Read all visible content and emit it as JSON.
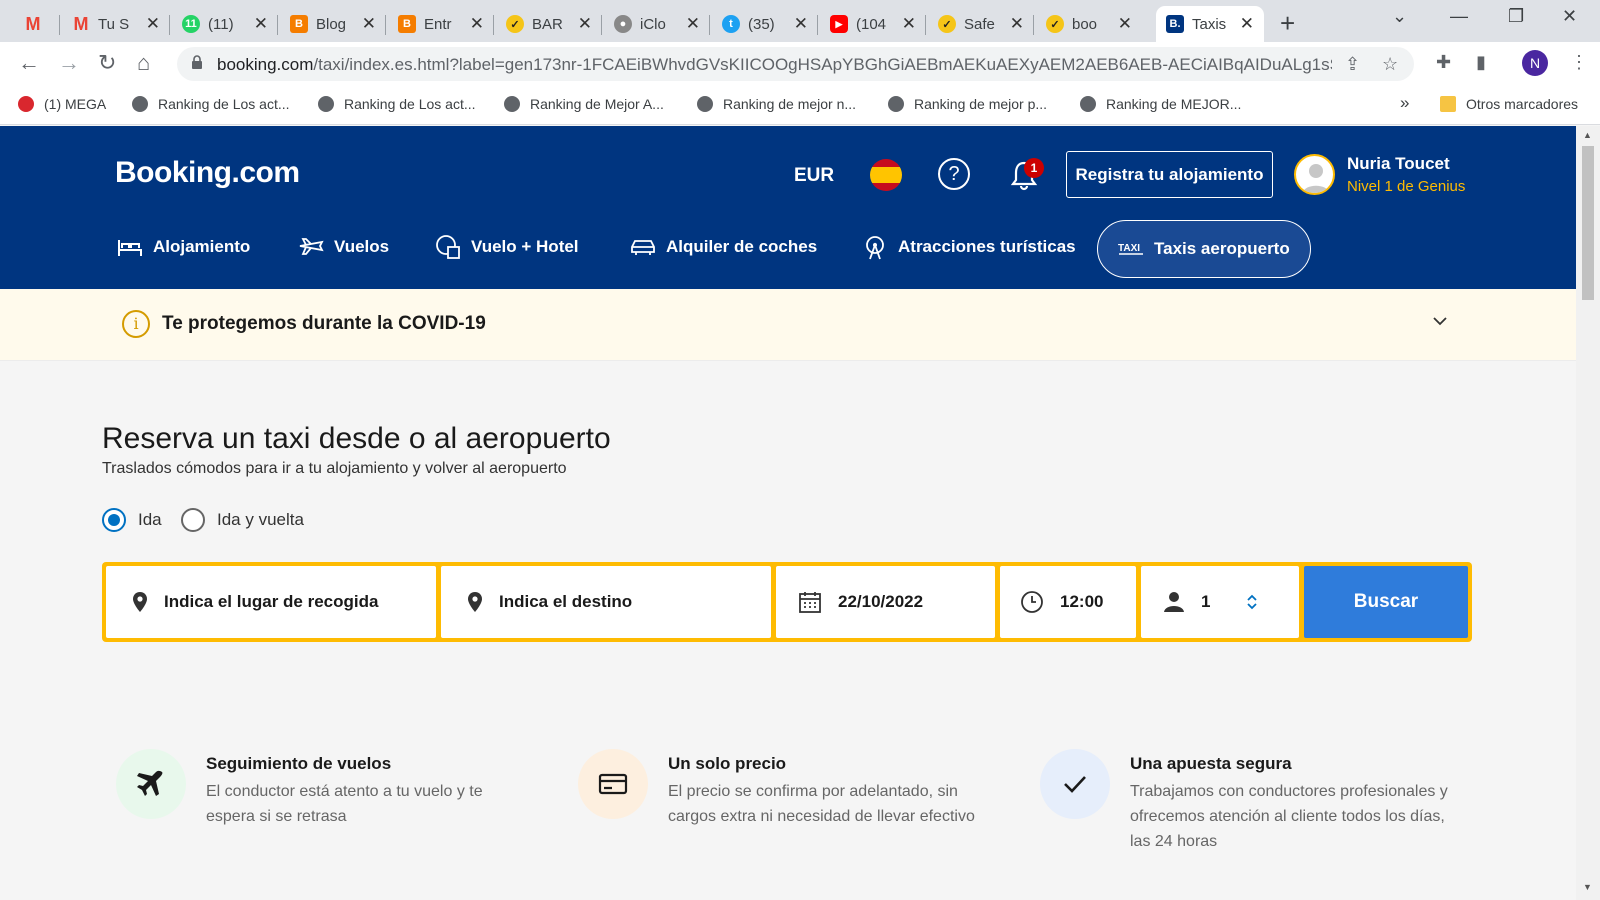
{
  "browser": {
    "tabs": [
      {
        "label": "",
        "icon": "gmail-icon",
        "color": "#ea4335"
      },
      {
        "label": "Tu S",
        "icon": "gmail-icon",
        "color": "#ea4335"
      },
      {
        "label": "(11)",
        "icon": "whatsapp-icon",
        "color": "#25d366"
      },
      {
        "label": "Blog",
        "icon": "blogger-icon",
        "color": "#f57d00"
      },
      {
        "label": "Entr",
        "icon": "blogger-icon",
        "color": "#f57d00"
      },
      {
        "label": "BAR",
        "icon": "check-icon",
        "color": "#f5c518"
      },
      {
        "label": "iClo",
        "icon": "apple-icon",
        "color": "#555555"
      },
      {
        "label": "(35)",
        "icon": "twitter-icon",
        "color": "#1da1f2"
      },
      {
        "label": "(104",
        "icon": "youtube-icon",
        "color": "#ff0000"
      },
      {
        "label": "Safe",
        "icon": "check-icon",
        "color": "#f5c518"
      },
      {
        "label": "boo",
        "icon": "check-icon",
        "color": "#f5c518"
      },
      {
        "label": "Taxis",
        "icon": "booking-icon",
        "color": "#003580"
      }
    ],
    "url_domain": "booking.com",
    "url_path": "/taxi/index.es.html?label=gen173nr-1FCAEiBWhvdGVsKIICOOgHSApYBGhGiAEBmAEKuAEXyAEM2AEB6AEB-AECiAIBqAIDuALg1sSa...",
    "profile_initial": "N",
    "bookmarks": [
      {
        "label": "(1) MEGA",
        "icon": "mega-icon",
        "color": "#d9272e"
      },
      {
        "label": "Ranking de Los act...",
        "icon": "globe-icon",
        "color": "#5f6368"
      },
      {
        "label": "Ranking de Los act...",
        "icon": "globe-icon",
        "color": "#5f6368"
      },
      {
        "label": "Ranking de Mejor A...",
        "icon": "globe-icon",
        "color": "#5f6368"
      },
      {
        "label": "Ranking de mejor n...",
        "icon": "globe-icon",
        "color": "#5f6368"
      },
      {
        "label": "Ranking de mejor p...",
        "icon": "globe-icon",
        "color": "#5f6368"
      },
      {
        "label": "Ranking de MEJOR...",
        "icon": "globe-icon",
        "color": "#5f6368"
      }
    ],
    "bookmarks_overflow": "»",
    "other_bookmarks": "Otros marcadores"
  },
  "header": {
    "logo": "Booking.com",
    "currency": "EUR",
    "notifications_count": "1",
    "register_label": "Registra tu alojamiento",
    "user_name": "Nuria Toucet",
    "user_level": "Nivel 1 de Genius",
    "nav": [
      {
        "label": "Alojamiento",
        "icon": "bed-icon"
      },
      {
        "label": "Vuelos",
        "icon": "plane-icon"
      },
      {
        "label": "Vuelo + Hotel",
        "icon": "plane-hotel-icon"
      },
      {
        "label": "Alquiler de coches",
        "icon": "car-icon"
      },
      {
        "label": "Atracciones turísticas",
        "icon": "attractions-icon"
      },
      {
        "label": "Taxis aeropuerto",
        "icon": "taxi-icon",
        "active": true
      }
    ]
  },
  "covid": {
    "text": "Te protegemos durante la COVID-19"
  },
  "main": {
    "title": "Reserva un taxi desde o al aeropuerto",
    "subtitle": "Traslados cómodos para ir a tu alojamiento y volver al aeropuerto",
    "trip_options": [
      {
        "label": "Ida",
        "checked": true
      },
      {
        "label": "Ida y vuelta",
        "checked": false
      }
    ],
    "search": {
      "pickup": "Indica el lugar de recogida",
      "destination": "Indica el destino",
      "date": "22/10/2022",
      "time": "12:00",
      "passengers": "1",
      "button": "Buscar"
    },
    "features": [
      {
        "title": "Seguimiento de vuelos",
        "desc": "El conductor está atento a tu vuelo y te espera si se retrasa",
        "icon": "plane-icon",
        "bg": "#e8f8ec"
      },
      {
        "title": "Un solo precio",
        "desc": "El precio se confirma por adelantado, sin cargos extra ni necesidad de llevar efectivo",
        "icon": "credit-card-icon",
        "bg": "#fdefdf"
      },
      {
        "title": "Una apuesta segura",
        "desc": "Trabajamos con conductores profesionales y ofrecemos atención al cliente todos los días, las 24 horas",
        "icon": "checkmark-icon",
        "bg": "#e6eefb"
      }
    ]
  },
  "colors": {
    "brand_blue": "#003580",
    "accent_yellow": "#febb02",
    "button_blue": "#2f7cdb"
  }
}
